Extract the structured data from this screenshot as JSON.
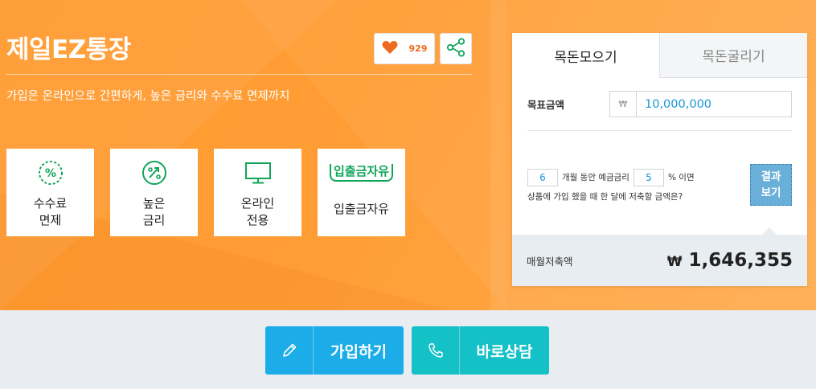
{
  "product": {
    "title": "제일EZ통장",
    "subtitle": "가입은 온라인으로 간편하게, 높은 금리와 수수료 면제까지",
    "like_count": "929"
  },
  "features": [
    {
      "label": "수수료\n면제",
      "icon": "percent-circle-icon"
    },
    {
      "label": "높은\n금리",
      "icon": "percent-up-icon"
    },
    {
      "label": "온라인\n전용",
      "icon": "monitor-icon"
    },
    {
      "badge": "입출금자유",
      "label": "입출금자유",
      "icon": "badge-text"
    }
  ],
  "calculator": {
    "tabs": [
      "목돈모으기",
      "목돈굴리기"
    ],
    "active_tab": 0,
    "goal_label": "목표금액",
    "currency_symbol": "₩",
    "goal_value": "10,000,000",
    "months_value": "6",
    "text_months": "개월 동안 예금금리",
    "rate_value": "5",
    "text_rate": "% 이면",
    "text_question": "상품에 가입 했을 때 한 달에 저축할 금액은?",
    "result_button": "결과\n보기",
    "monthly_label": "매월저축액",
    "monthly_currency": "₩",
    "monthly_value": "1,646,355"
  },
  "actions": {
    "join_label": "가입하기",
    "consult_label": "바로상담"
  },
  "colors": {
    "hero": "#ff9d35",
    "join": "#1cade9",
    "consult": "#14c1c7",
    "accent_green": "#11a55a",
    "heart": "#ee6a1e"
  }
}
